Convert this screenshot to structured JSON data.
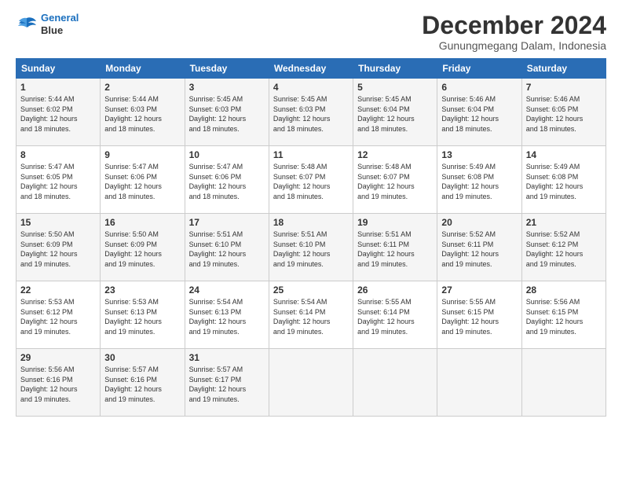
{
  "logo": {
    "line1": "General",
    "line2": "Blue"
  },
  "header": {
    "title": "December 2024",
    "subtitle": "Gunungmegang Dalam, Indonesia"
  },
  "calendar": {
    "columns": [
      "Sunday",
      "Monday",
      "Tuesday",
      "Wednesday",
      "Thursday",
      "Friday",
      "Saturday"
    ],
    "weeks": [
      [
        {
          "day": "",
          "sunrise": "",
          "sunset": "",
          "daylight": ""
        },
        {
          "day": "2",
          "sunrise": "Sunrise: 5:44 AM",
          "sunset": "Sunset: 6:03 PM",
          "daylight": "Daylight: 12 hours and 18 minutes."
        },
        {
          "day": "3",
          "sunrise": "Sunrise: 5:45 AM",
          "sunset": "Sunset: 6:03 PM",
          "daylight": "Daylight: 12 hours and 18 minutes."
        },
        {
          "day": "4",
          "sunrise": "Sunrise: 5:45 AM",
          "sunset": "Sunset: 6:03 PM",
          "daylight": "Daylight: 12 hours and 18 minutes."
        },
        {
          "day": "5",
          "sunrise": "Sunrise: 5:45 AM",
          "sunset": "Sunset: 6:04 PM",
          "daylight": "Daylight: 12 hours and 18 minutes."
        },
        {
          "day": "6",
          "sunrise": "Sunrise: 5:46 AM",
          "sunset": "Sunset: 6:04 PM",
          "daylight": "Daylight: 12 hours and 18 minutes."
        },
        {
          "day": "7",
          "sunrise": "Sunrise: 5:46 AM",
          "sunset": "Sunset: 6:05 PM",
          "daylight": "Daylight: 12 hours and 18 minutes."
        }
      ],
      [
        {
          "day": "1",
          "sunrise": "Sunrise: 5:44 AM",
          "sunset": "Sunset: 6:02 PM",
          "daylight": "Daylight: 12 hours and 18 minutes."
        },
        {
          "day": "9",
          "sunrise": "Sunrise: 5:47 AM",
          "sunset": "Sunset: 6:06 PM",
          "daylight": "Daylight: 12 hours and 18 minutes."
        },
        {
          "day": "10",
          "sunrise": "Sunrise: 5:47 AM",
          "sunset": "Sunset: 6:06 PM",
          "daylight": "Daylight: 12 hours and 18 minutes."
        },
        {
          "day": "11",
          "sunrise": "Sunrise: 5:48 AM",
          "sunset": "Sunset: 6:07 PM",
          "daylight": "Daylight: 12 hours and 18 minutes."
        },
        {
          "day": "12",
          "sunrise": "Sunrise: 5:48 AM",
          "sunset": "Sunset: 6:07 PM",
          "daylight": "Daylight: 12 hours and 19 minutes."
        },
        {
          "day": "13",
          "sunrise": "Sunrise: 5:49 AM",
          "sunset": "Sunset: 6:08 PM",
          "daylight": "Daylight: 12 hours and 19 minutes."
        },
        {
          "day": "14",
          "sunrise": "Sunrise: 5:49 AM",
          "sunset": "Sunset: 6:08 PM",
          "daylight": "Daylight: 12 hours and 19 minutes."
        }
      ],
      [
        {
          "day": "8",
          "sunrise": "Sunrise: 5:47 AM",
          "sunset": "Sunset: 6:05 PM",
          "daylight": "Daylight: 12 hours and 18 minutes."
        },
        {
          "day": "16",
          "sunrise": "Sunrise: 5:50 AM",
          "sunset": "Sunset: 6:09 PM",
          "daylight": "Daylight: 12 hours and 19 minutes."
        },
        {
          "day": "17",
          "sunrise": "Sunrise: 5:51 AM",
          "sunset": "Sunset: 6:10 PM",
          "daylight": "Daylight: 12 hours and 19 minutes."
        },
        {
          "day": "18",
          "sunrise": "Sunrise: 5:51 AM",
          "sunset": "Sunset: 6:10 PM",
          "daylight": "Daylight: 12 hours and 19 minutes."
        },
        {
          "day": "19",
          "sunrise": "Sunrise: 5:51 AM",
          "sunset": "Sunset: 6:11 PM",
          "daylight": "Daylight: 12 hours and 19 minutes."
        },
        {
          "day": "20",
          "sunrise": "Sunrise: 5:52 AM",
          "sunset": "Sunset: 6:11 PM",
          "daylight": "Daylight: 12 hours and 19 minutes."
        },
        {
          "day": "21",
          "sunrise": "Sunrise: 5:52 AM",
          "sunset": "Sunset: 6:12 PM",
          "daylight": "Daylight: 12 hours and 19 minutes."
        }
      ],
      [
        {
          "day": "15",
          "sunrise": "Sunrise: 5:50 AM",
          "sunset": "Sunset: 6:09 PM",
          "daylight": "Daylight: 12 hours and 19 minutes."
        },
        {
          "day": "23",
          "sunrise": "Sunrise: 5:53 AM",
          "sunset": "Sunset: 6:13 PM",
          "daylight": "Daylight: 12 hours and 19 minutes."
        },
        {
          "day": "24",
          "sunrise": "Sunrise: 5:54 AM",
          "sunset": "Sunset: 6:13 PM",
          "daylight": "Daylight: 12 hours and 19 minutes."
        },
        {
          "day": "25",
          "sunrise": "Sunrise: 5:54 AM",
          "sunset": "Sunset: 6:14 PM",
          "daylight": "Daylight: 12 hours and 19 minutes."
        },
        {
          "day": "26",
          "sunrise": "Sunrise: 5:55 AM",
          "sunset": "Sunset: 6:14 PM",
          "daylight": "Daylight: 12 hours and 19 minutes."
        },
        {
          "day": "27",
          "sunrise": "Sunrise: 5:55 AM",
          "sunset": "Sunset: 6:15 PM",
          "daylight": "Daylight: 12 hours and 19 minutes."
        },
        {
          "day": "28",
          "sunrise": "Sunrise: 5:56 AM",
          "sunset": "Sunset: 6:15 PM",
          "daylight": "Daylight: 12 hours and 19 minutes."
        }
      ],
      [
        {
          "day": "22",
          "sunrise": "Sunrise: 5:53 AM",
          "sunset": "Sunset: 6:12 PM",
          "daylight": "Daylight: 12 hours and 19 minutes."
        },
        {
          "day": "30",
          "sunrise": "Sunrise: 5:57 AM",
          "sunset": "Sunset: 6:16 PM",
          "daylight": "Daylight: 12 hours and 19 minutes."
        },
        {
          "day": "31",
          "sunrise": "Sunrise: 5:57 AM",
          "sunset": "Sunset: 6:17 PM",
          "daylight": "Daylight: 12 hours and 19 minutes."
        },
        {
          "day": "",
          "sunrise": "",
          "sunset": "",
          "daylight": ""
        },
        {
          "day": "",
          "sunrise": "",
          "sunset": "",
          "daylight": ""
        },
        {
          "day": "",
          "sunrise": "",
          "sunset": "",
          "daylight": ""
        },
        {
          "day": "",
          "sunrise": "",
          "sunset": "",
          "daylight": ""
        }
      ],
      [
        {
          "day": "29",
          "sunrise": "Sunrise: 5:56 AM",
          "sunset": "Sunset: 6:16 PM",
          "daylight": "Daylight: 12 hours and 19 minutes."
        },
        {
          "day": "",
          "sunrise": "",
          "sunset": "",
          "daylight": ""
        },
        {
          "day": "",
          "sunrise": "",
          "sunset": "",
          "daylight": ""
        },
        {
          "day": "",
          "sunrise": "",
          "sunset": "",
          "daylight": ""
        },
        {
          "day": "",
          "sunrise": "",
          "sunset": "",
          "daylight": ""
        },
        {
          "day": "",
          "sunrise": "",
          "sunset": "",
          "daylight": ""
        },
        {
          "day": "",
          "sunrise": "",
          "sunset": "",
          "daylight": ""
        }
      ]
    ]
  }
}
